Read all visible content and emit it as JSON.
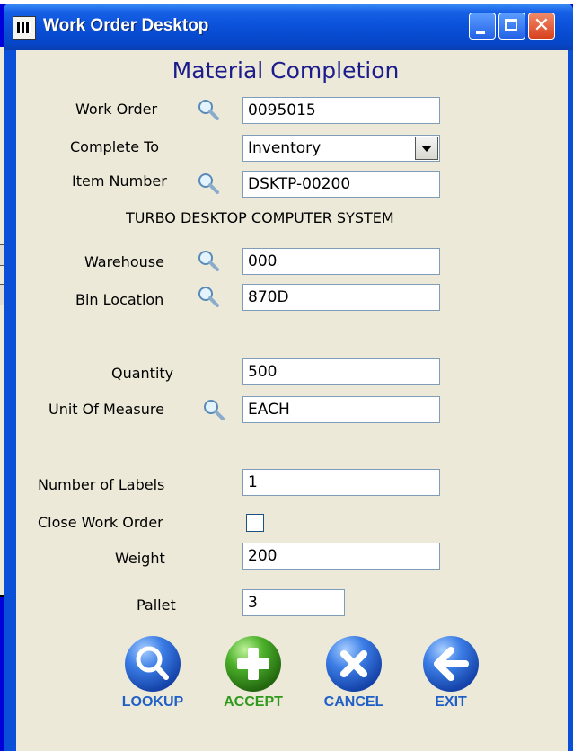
{
  "window": {
    "title": "Work Order Desktop"
  },
  "form": {
    "heading": "Material Completion",
    "work_order": {
      "label": "Work Order",
      "value": "0095015"
    },
    "complete_to": {
      "label": "Complete To",
      "value": "Inventory"
    },
    "item_number": {
      "label": "Item Number",
      "value": "DSKTP-00200",
      "description": "TURBO DESKTOP COMPUTER SYSTEM"
    },
    "warehouse": {
      "label": "Warehouse",
      "value": "000"
    },
    "bin_location": {
      "label": "Bin Location",
      "value": "870D"
    },
    "quantity": {
      "label": "Quantity",
      "value": "500"
    },
    "unit_of_measure": {
      "label": "Unit Of Measure",
      "value": "EACH"
    },
    "number_of_labels": {
      "label": "Number of Labels",
      "value": "1"
    },
    "close_work_order": {
      "label": "Close Work Order",
      "checked": false
    },
    "weight": {
      "label": "Weight",
      "value": "200"
    },
    "pallet": {
      "label": "Pallet",
      "value": "3"
    }
  },
  "actions": {
    "lookup": {
      "label": "LOOKUP",
      "icon": "magnifier-icon"
    },
    "accept": {
      "label": "ACCEPT",
      "icon": "plus-icon"
    },
    "cancel": {
      "label": "CANCEL",
      "icon": "x-icon"
    },
    "exit": {
      "label": "EXIT",
      "icon": "left-arrow-icon"
    }
  },
  "colors": {
    "accent_blue": "#1f5fc8",
    "accent_green": "#2f9a1c",
    "titlebar": "#0a50d8",
    "heading": "#1c1c8c"
  }
}
